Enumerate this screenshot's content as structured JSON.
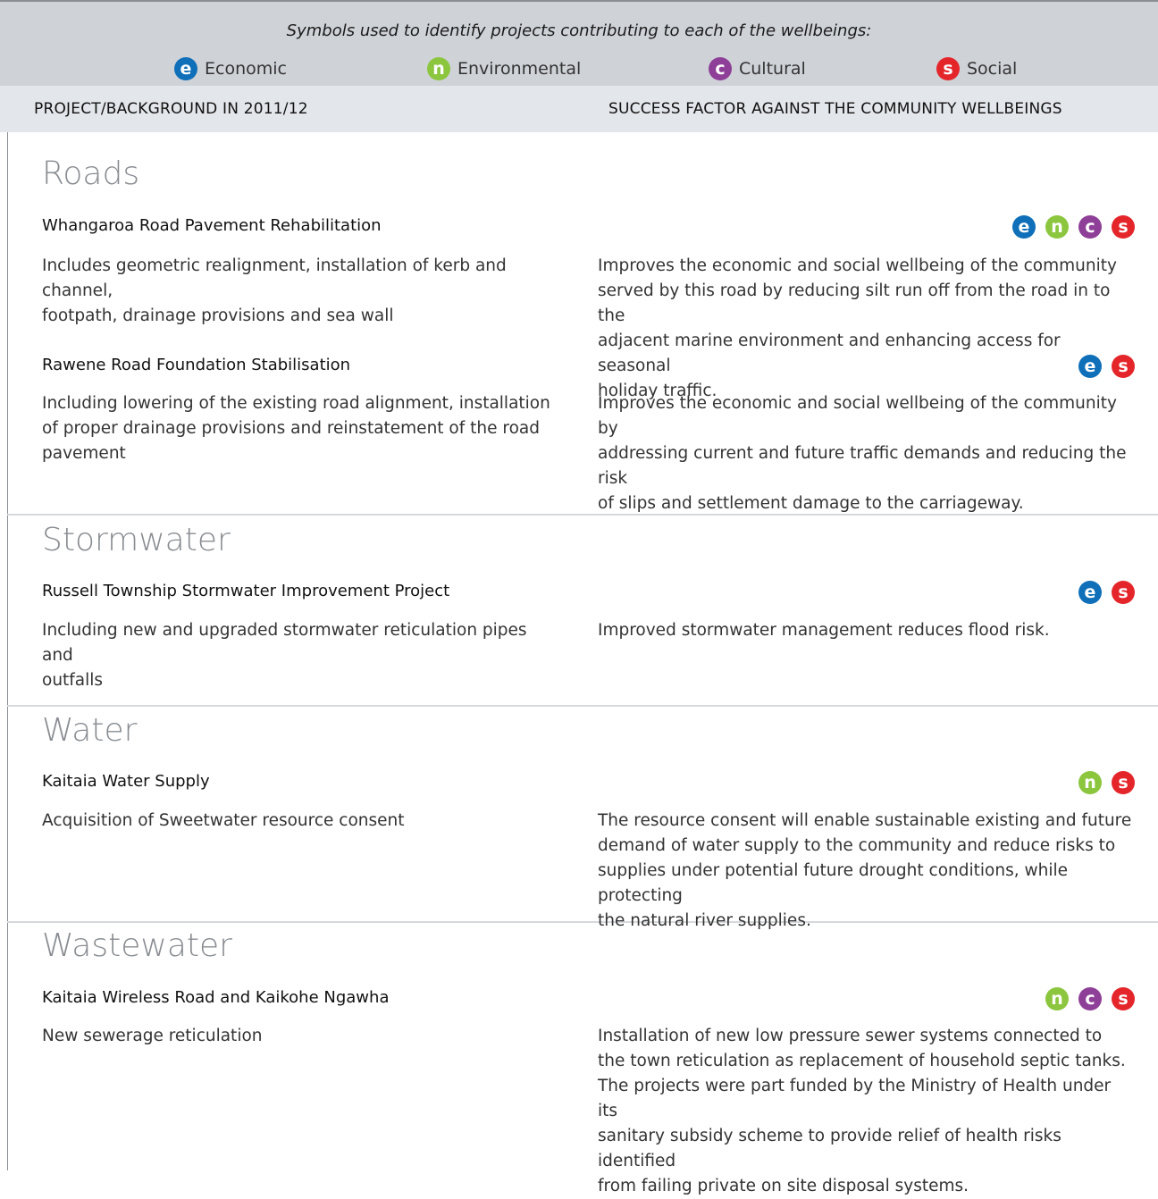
{
  "legend": {
    "title": "Symbols used to identify projects contributing to each of the wellbeings:",
    "items": [
      {
        "symbol": "e",
        "label": "Economic",
        "color": "#0f6fb8"
      },
      {
        "symbol": "n",
        "label": "Environmental",
        "color": "#8cc63f"
      },
      {
        "symbol": "c",
        "label": "Cultural",
        "color": "#8e3f97"
      },
      {
        "symbol": "s",
        "label": "Social",
        "color": "#e4262b"
      }
    ]
  },
  "header": {
    "left": "PROJECT/BACKGROUND IN 2011/12",
    "right": "SUCCESS FACTOR AGAINST THE COMMUNITY WELLBEINGS"
  },
  "sections": [
    {
      "title": "Roads",
      "projects": [
        {
          "title": "Whangaroa Road Pavement Rehabilitation",
          "symbols": [
            "e",
            "n",
            "c",
            "s"
          ],
          "background": "Includes geometric realignment, installation of kerb and channel,\nfootpath, drainage provisions and sea wall",
          "success": "Improves the economic and social wellbeing of the community\nserved by this road by reducing silt run off from the road in to the\nadjacent marine environment and enhancing access for seasonal\nholiday traffic."
        },
        {
          "title": "Rawene Road Foundation Stabilisation",
          "symbols": [
            "e",
            "s"
          ],
          "background": "Including lowering of the existing road alignment, installation\nof proper drainage provisions and reinstatement of the road\npavement",
          "success": "Improves the economic and social wellbeing of the community by\naddressing current and future traffic demands and reducing the risk\nof slips and settlement damage to the carriageway."
        }
      ]
    },
    {
      "title": "Stormwater",
      "projects": [
        {
          "title": "Russell Township Stormwater Improvement Project",
          "symbols": [
            "e",
            "s"
          ],
          "background": "Including new and upgraded stormwater reticulation pipes and\noutfalls",
          "success": "Improved stormwater management reduces flood risk."
        }
      ]
    },
    {
      "title": "Water",
      "projects": [
        {
          "title": "Kaitaia Water Supply",
          "symbols": [
            "n",
            "s"
          ],
          "background": "Acquisition of Sweetwater resource consent",
          "success": "The resource consent will enable sustainable existing and future\ndemand of water supply to the community and reduce risks to\nsupplies under potential future drought conditions, while protecting\nthe natural river supplies."
        }
      ]
    },
    {
      "title": "Wastewater",
      "projects": [
        {
          "title": "Kaitaia Wireless Road and Kaikohe Ngawha",
          "symbols": [
            "n",
            "c",
            "s"
          ],
          "background": "New sewerage reticulation",
          "success": "Installation of new low pressure sewer systems connected to\nthe town reticulation as replacement of household septic tanks.\nThe projects were part funded by the Ministry of Health under its\nsanitary subsidy scheme to provide relief of health risks identified\nfrom failing private on site disposal systems."
        }
      ]
    }
  ]
}
